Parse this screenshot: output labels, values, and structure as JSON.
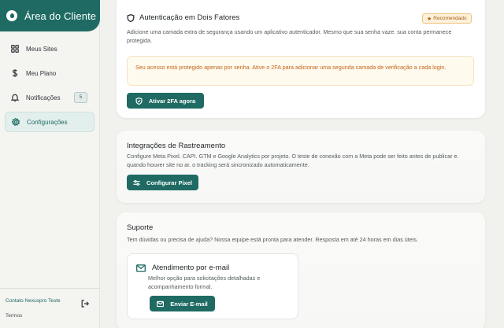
{
  "brand": {
    "title": "Área do Cliente"
  },
  "sidebar": {
    "items": [
      {
        "label": "Meus Sites",
        "icon": "grid-icon"
      },
      {
        "label": "Meu Plano",
        "icon": "dollar-icon"
      },
      {
        "label": "Notificações",
        "icon": "bell-icon",
        "badge": "5"
      },
      {
        "label": "Configurações",
        "icon": "gear-icon",
        "active": true
      }
    ],
    "contact": "Contato Nexuspro Teste",
    "terms": "Termos"
  },
  "twofa": {
    "title": "Autenticação em Dois Fatores",
    "badge": "Recomendado",
    "description": "Adicione uma camada extra de segurança usando um aplicativo autenticador. Mesmo que sua senha vaze. sua conta permanece protegida.",
    "warning": "Seu acesso está protegido apenas por senha. Ative o 2FA para adicionar uma segunda camada de verificação a cada login.",
    "button": "Ativar 2FA agora"
  },
  "tracking": {
    "title": "Integrações de Rastreamento",
    "description": "Configure Meta Pixel. CAPI. GTM e Google Analytics por projeto. O teste de conexão com a Meta pode ser feito antes de publicar e. quando houver site no ar. o tracking será sincronizado automaticamente.",
    "button": "Configurar Pixel"
  },
  "support": {
    "title": "Suporte",
    "description": "Tem dúvidas ou precisa de ajuda? Nossa equipe está pronta para atender. Resposta em até 24 horas em dias úteis.",
    "email": {
      "title": "Atendimento por e-mail",
      "description": "Melhor opção para solicitações detalhadas e acompanhamento formal.",
      "button": "Enviar E-mail"
    }
  },
  "colors": {
    "accent": "#1f6b63",
    "warning_text": "#c0641b",
    "warning_bg": "#fffaee",
    "badge_bg": "#fdf1dc"
  }
}
